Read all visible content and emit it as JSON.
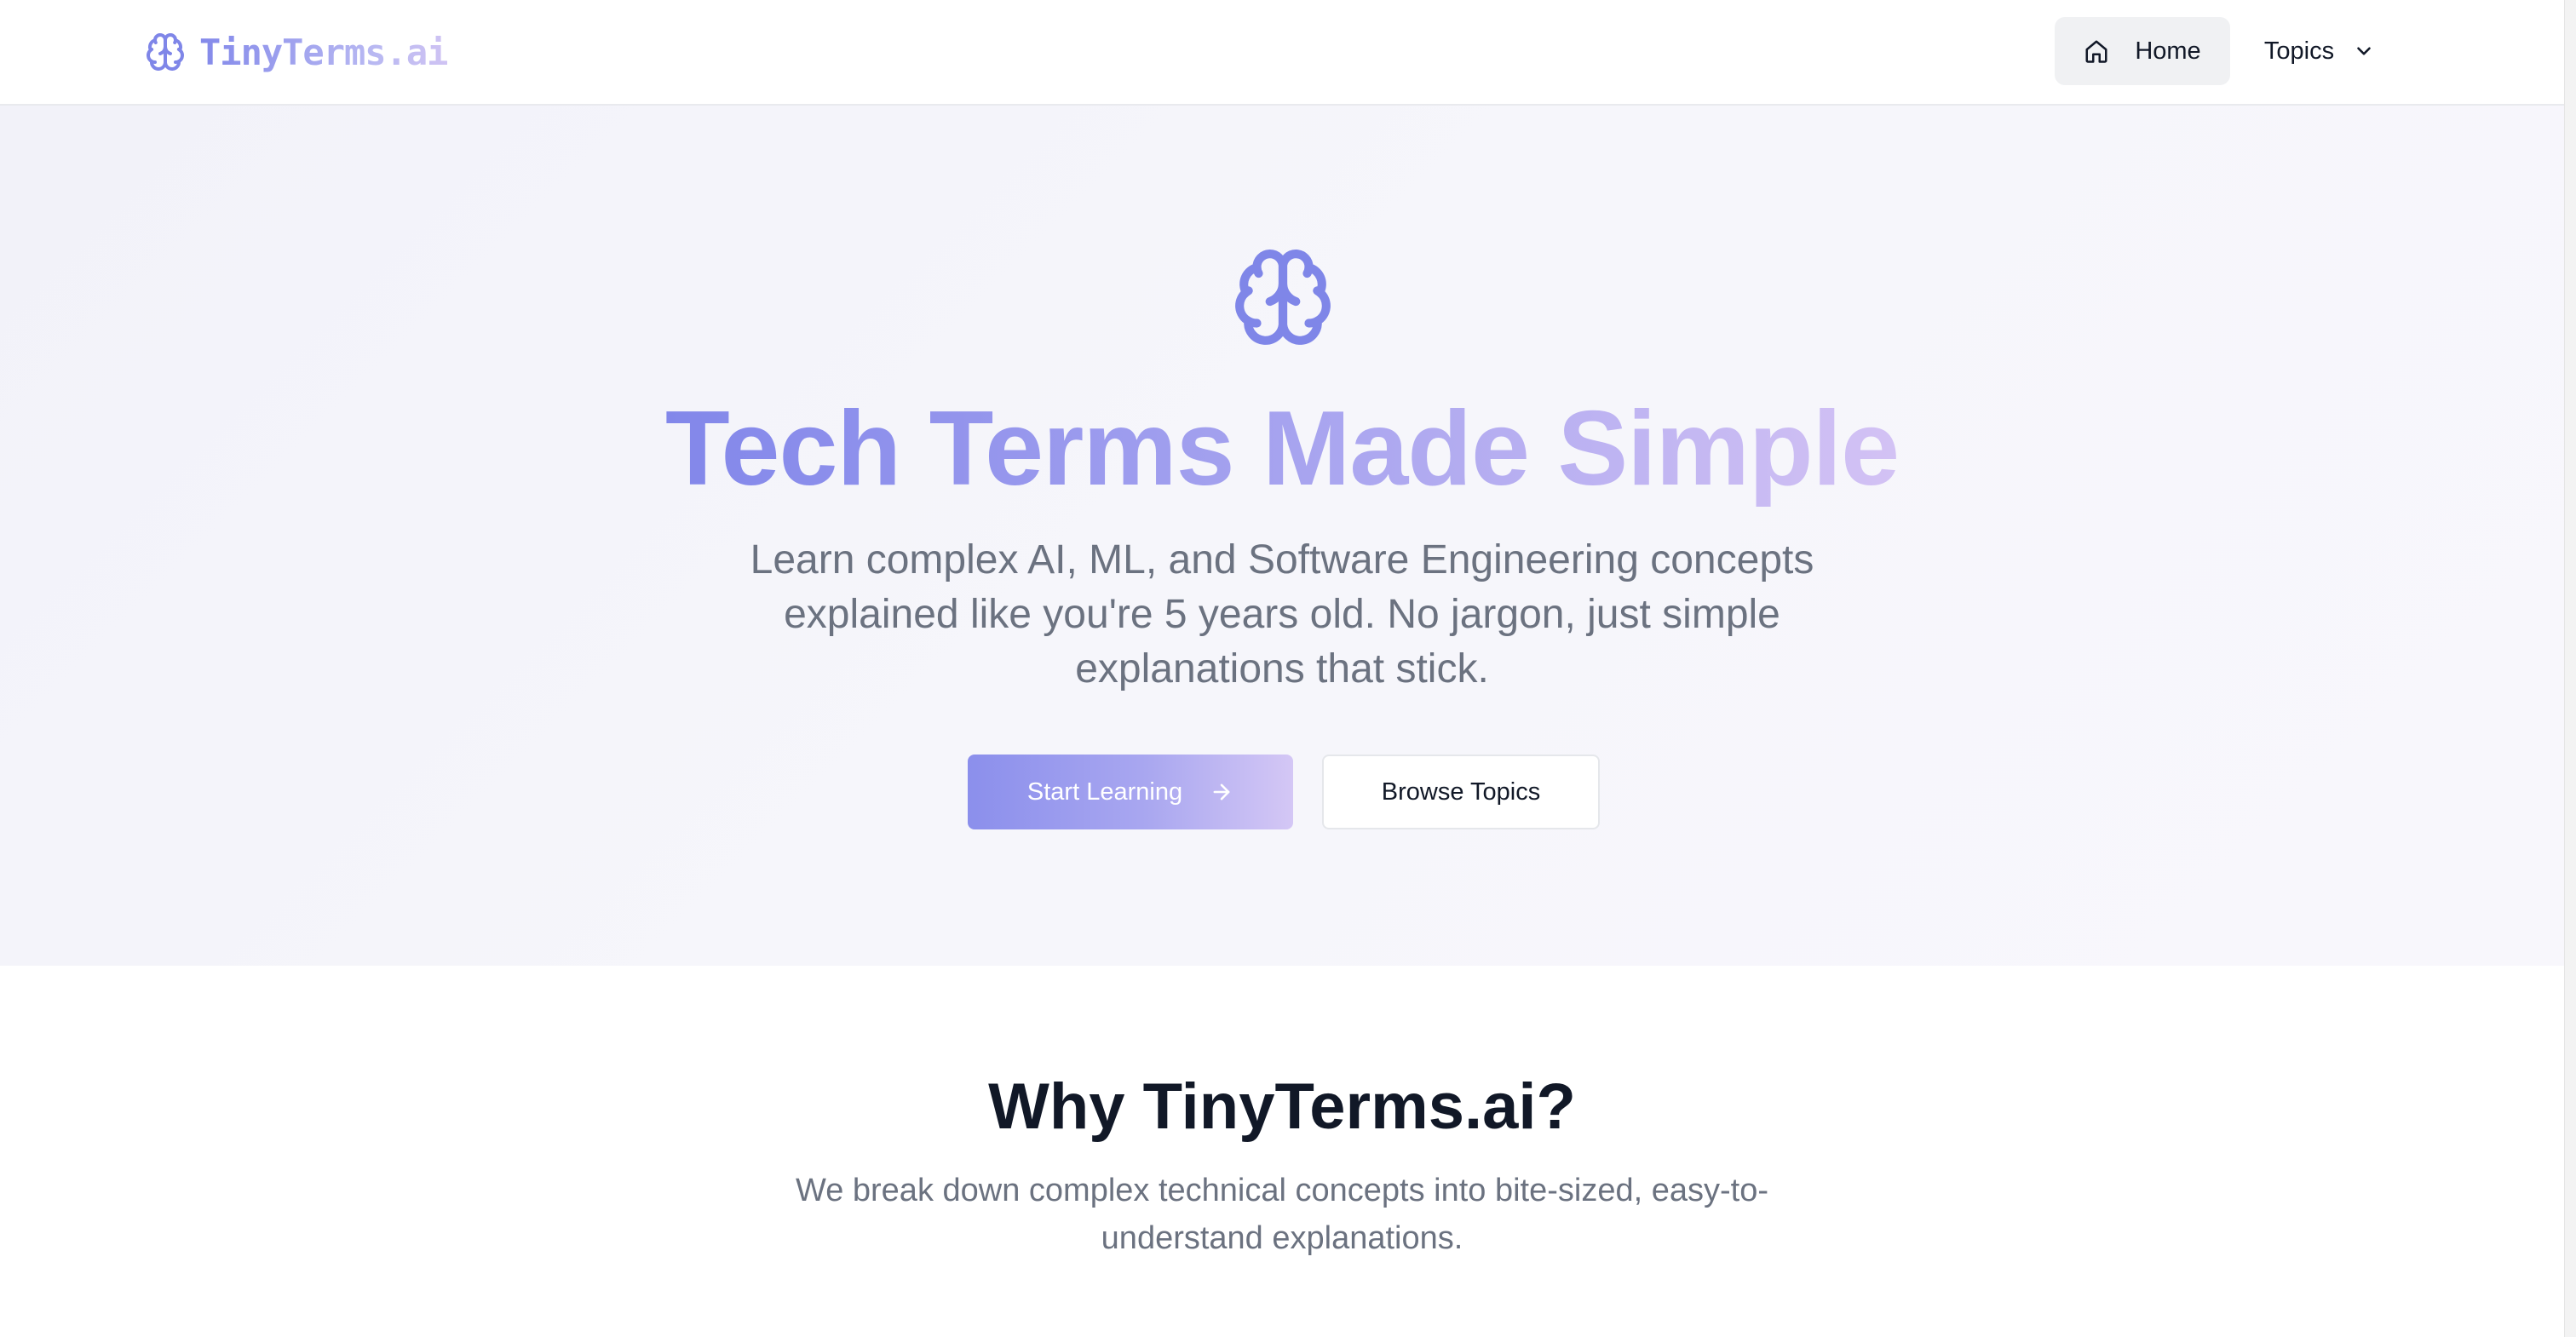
{
  "header": {
    "brand": "TinyTerms.ai",
    "nav": {
      "home": "Home",
      "topics": "Topics"
    }
  },
  "hero": {
    "title": "Tech Terms Made Simple",
    "subtitle": "Learn complex AI, ML, and Software Engineering concepts explained like you're 5 years old. No jargon, just simple explanations that stick.",
    "primary_cta": "Start Learning",
    "secondary_cta": "Browse Topics"
  },
  "why": {
    "title": "Why TinyTerms.ai?",
    "subtitle": "We break down complex technical concepts into bite-sized, easy-to-understand explanations."
  },
  "colors": {
    "accent_start": "#8287ea",
    "accent_end": "#d3c2f4",
    "text_dark": "#111827",
    "text_muted": "#6b7280"
  },
  "icons": {
    "brand": "brain-icon",
    "hero": "brain-icon",
    "home": "home-icon",
    "topics": "chevron-down-icon",
    "cta": "arrow-right-icon"
  }
}
